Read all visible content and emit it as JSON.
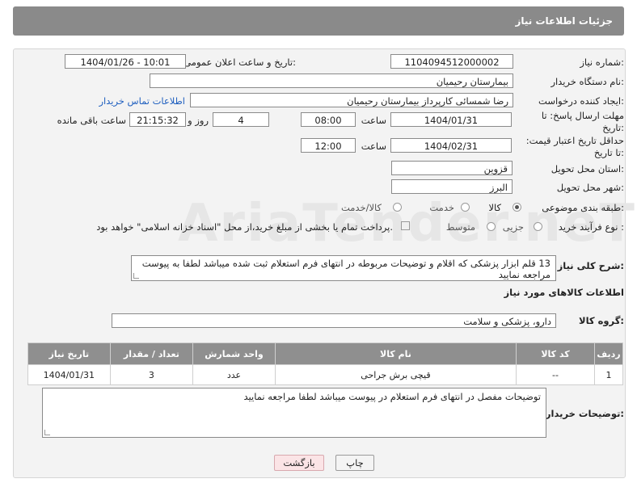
{
  "header": {
    "title": "جزئیات اطلاعات نیاز"
  },
  "fields": {
    "need_number_label": "شماره نیاز:",
    "need_number": "1104094512000002",
    "announce_label": "تاریخ و ساعت اعلان عمومی:",
    "announce_value": "1404/01/26 - 10:01",
    "buyer_org_label": "نام دستگاه خریدار:",
    "buyer_org": "بیمارستان رحیمیان",
    "creator_label": "ایجاد کننده درخواست:",
    "creator": "رضا شمسائی کارپرداز بیمارستان رحیمیان",
    "contact_link": "اطلاعات تماس خریدار",
    "reply_deadline_label": "مهلت ارسال پاسخ: تا تاریخ:",
    "reply_date": "1404/01/31",
    "time_label": "ساعت",
    "reply_time": "08:00",
    "days_value": "4",
    "days_and_label": "روز و",
    "remaining_time": "21:15:32",
    "remaining_label": "ساعت باقی مانده",
    "price_validity_label": "حداقل تاریخ اعتبار قیمت: تا تاریخ:",
    "price_date": "1404/02/31",
    "price_time": "12:00",
    "province_label": "استان محل تحویل:",
    "province": "قزوین",
    "city_label": "شهر محل تحویل:",
    "city": "البرز",
    "category_label": "طبقه بندی موضوعی:",
    "category_options": [
      "کالا",
      "خدمت",
      "کالا/خدمت"
    ],
    "category_selected": "کالا",
    "process_label": "نوع فرآیند خرید :",
    "process_options": [
      "جزیی",
      "متوسط"
    ],
    "process_selected": "جزیی",
    "payment_note": "پرداخت تمام یا بخشی از مبلغ خرید،از محل \"اسناد خزانه اسلامی\" خواهد بود.",
    "description_label": "شرح کلی نیاز:",
    "description": "13 قلم ابزار پزشکی که اقلام و توضیحات مربوطه در انتهای فرم استعلام ثبت شده میباشد  لطفا به پیوست مراجعه نمایید"
  },
  "goods": {
    "section_title": "اطلاعات کالاهای مورد نیاز",
    "group_label": "گروه کالا:",
    "group_value": "دارو، پزشکی و سلامت",
    "columns": [
      "ردیف",
      "کد کالا",
      "نام کالا",
      "واحد شمارش",
      "تعداد / مقدار",
      "تاریخ نیاز"
    ],
    "rows": [
      {
        "index": "1",
        "code": "--",
        "name": "قیچی برش جراحی",
        "unit": "عدد",
        "qty": "3",
        "date": "1404/01/31"
      }
    ]
  },
  "buyer_notes": {
    "label": "توضیحات خریدار:",
    "text": "توضیحات مفصل در انتهای فرم استعلام در پیوست میباشد لطفا مراجعه نمایید"
  },
  "buttons": {
    "print": "چاپ",
    "back": "بازگشت"
  },
  "watermark": {
    "text": "AriaTender.neT"
  },
  "colors": {
    "header_bg": "#8a8a8a",
    "panel_bg": "#f3f3f3",
    "link": "#1f5fbf",
    "back_button_bg": "#fbe4e6"
  }
}
